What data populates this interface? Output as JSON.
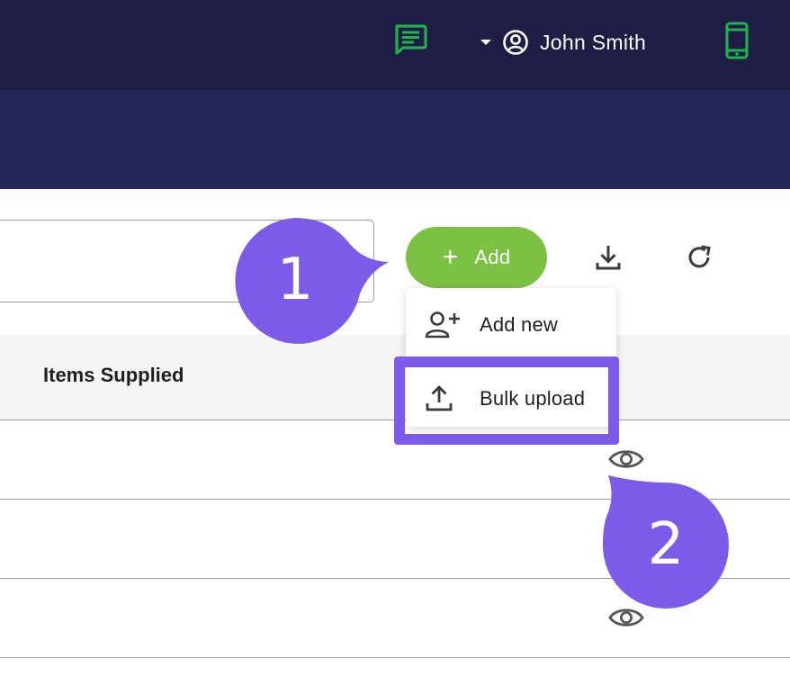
{
  "header": {
    "user_name": "John Smith",
    "icons": [
      "message-icon",
      "caret-down-icon",
      "user-circle-icon",
      "mobile-device-icon"
    ],
    "colors": {
      "topbar": "#1e1d46",
      "subbar": "#252456",
      "accent_green": "#22b14c"
    }
  },
  "toolbar": {
    "add_label": "Add",
    "add_color": "#7cc144",
    "icons": [
      "download-icon",
      "refresh-icon"
    ]
  },
  "search": {
    "value": "",
    "placeholder": ""
  },
  "add_menu": {
    "items": [
      {
        "label": "Add new",
        "icon": "add-user-icon"
      },
      {
        "label": "Bulk upload",
        "icon": "upload-icon"
      }
    ]
  },
  "table": {
    "columns": [
      "Items Supplied"
    ],
    "row_actions": [
      "view-eye-icon",
      "view-eye-icon"
    ]
  },
  "callouts": [
    {
      "number": "1",
      "color": "#7b5be8"
    },
    {
      "number": "2",
      "color": "#7b5be8"
    }
  ]
}
